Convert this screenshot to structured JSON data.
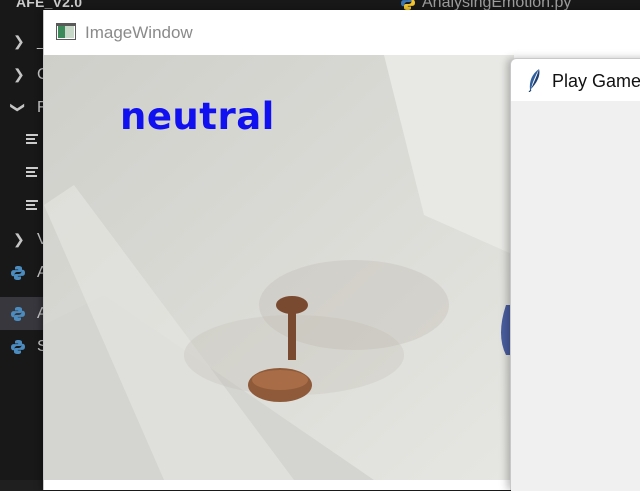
{
  "vscode": {
    "project_title": "AFE_V2.0",
    "editor_tab": {
      "label": "AnalysingEmotion.py",
      "icon": "python-icon"
    },
    "explorer_items": [
      {
        "type": "folder",
        "state": "collapsed",
        "label": "_",
        "icon": "chevron-right-icon"
      },
      {
        "type": "folder",
        "state": "collapsed",
        "label": "C",
        "icon": "chevron-right-icon"
      },
      {
        "type": "folder",
        "state": "expanded",
        "label": "F",
        "icon": "chevron-down-icon"
      },
      {
        "type": "file",
        "label": "",
        "icon": "text-file-icon"
      },
      {
        "type": "file",
        "label": "",
        "icon": "text-file-icon"
      },
      {
        "type": "file",
        "label": "",
        "icon": "text-file-icon"
      },
      {
        "type": "folder",
        "state": "collapsed",
        "label": "V",
        "icon": "chevron-right-icon"
      },
      {
        "type": "file",
        "label": "A",
        "icon": "python-icon"
      },
      {
        "type": "file",
        "label": "A",
        "icon": "python-icon",
        "selected": true
      },
      {
        "type": "file",
        "label": "S",
        "icon": "python-icon"
      }
    ]
  },
  "image_window": {
    "title": "ImageWindow",
    "icon": "image-window-icon",
    "detected_emotion": "neutral",
    "emotion_text_color": "#1010f0",
    "camera_scene": "ceiling-fan-camera-feed"
  },
  "game_window": {
    "title": "Play Game",
    "icon": "tk-feather-icon"
  },
  "colors": {
    "vscode_bg": "#1f1f1f",
    "vscode_sidebar": "#181818",
    "selected_row": "#37373d",
    "window_bg": "#ffffff",
    "game_body": "#f0f0f0"
  }
}
